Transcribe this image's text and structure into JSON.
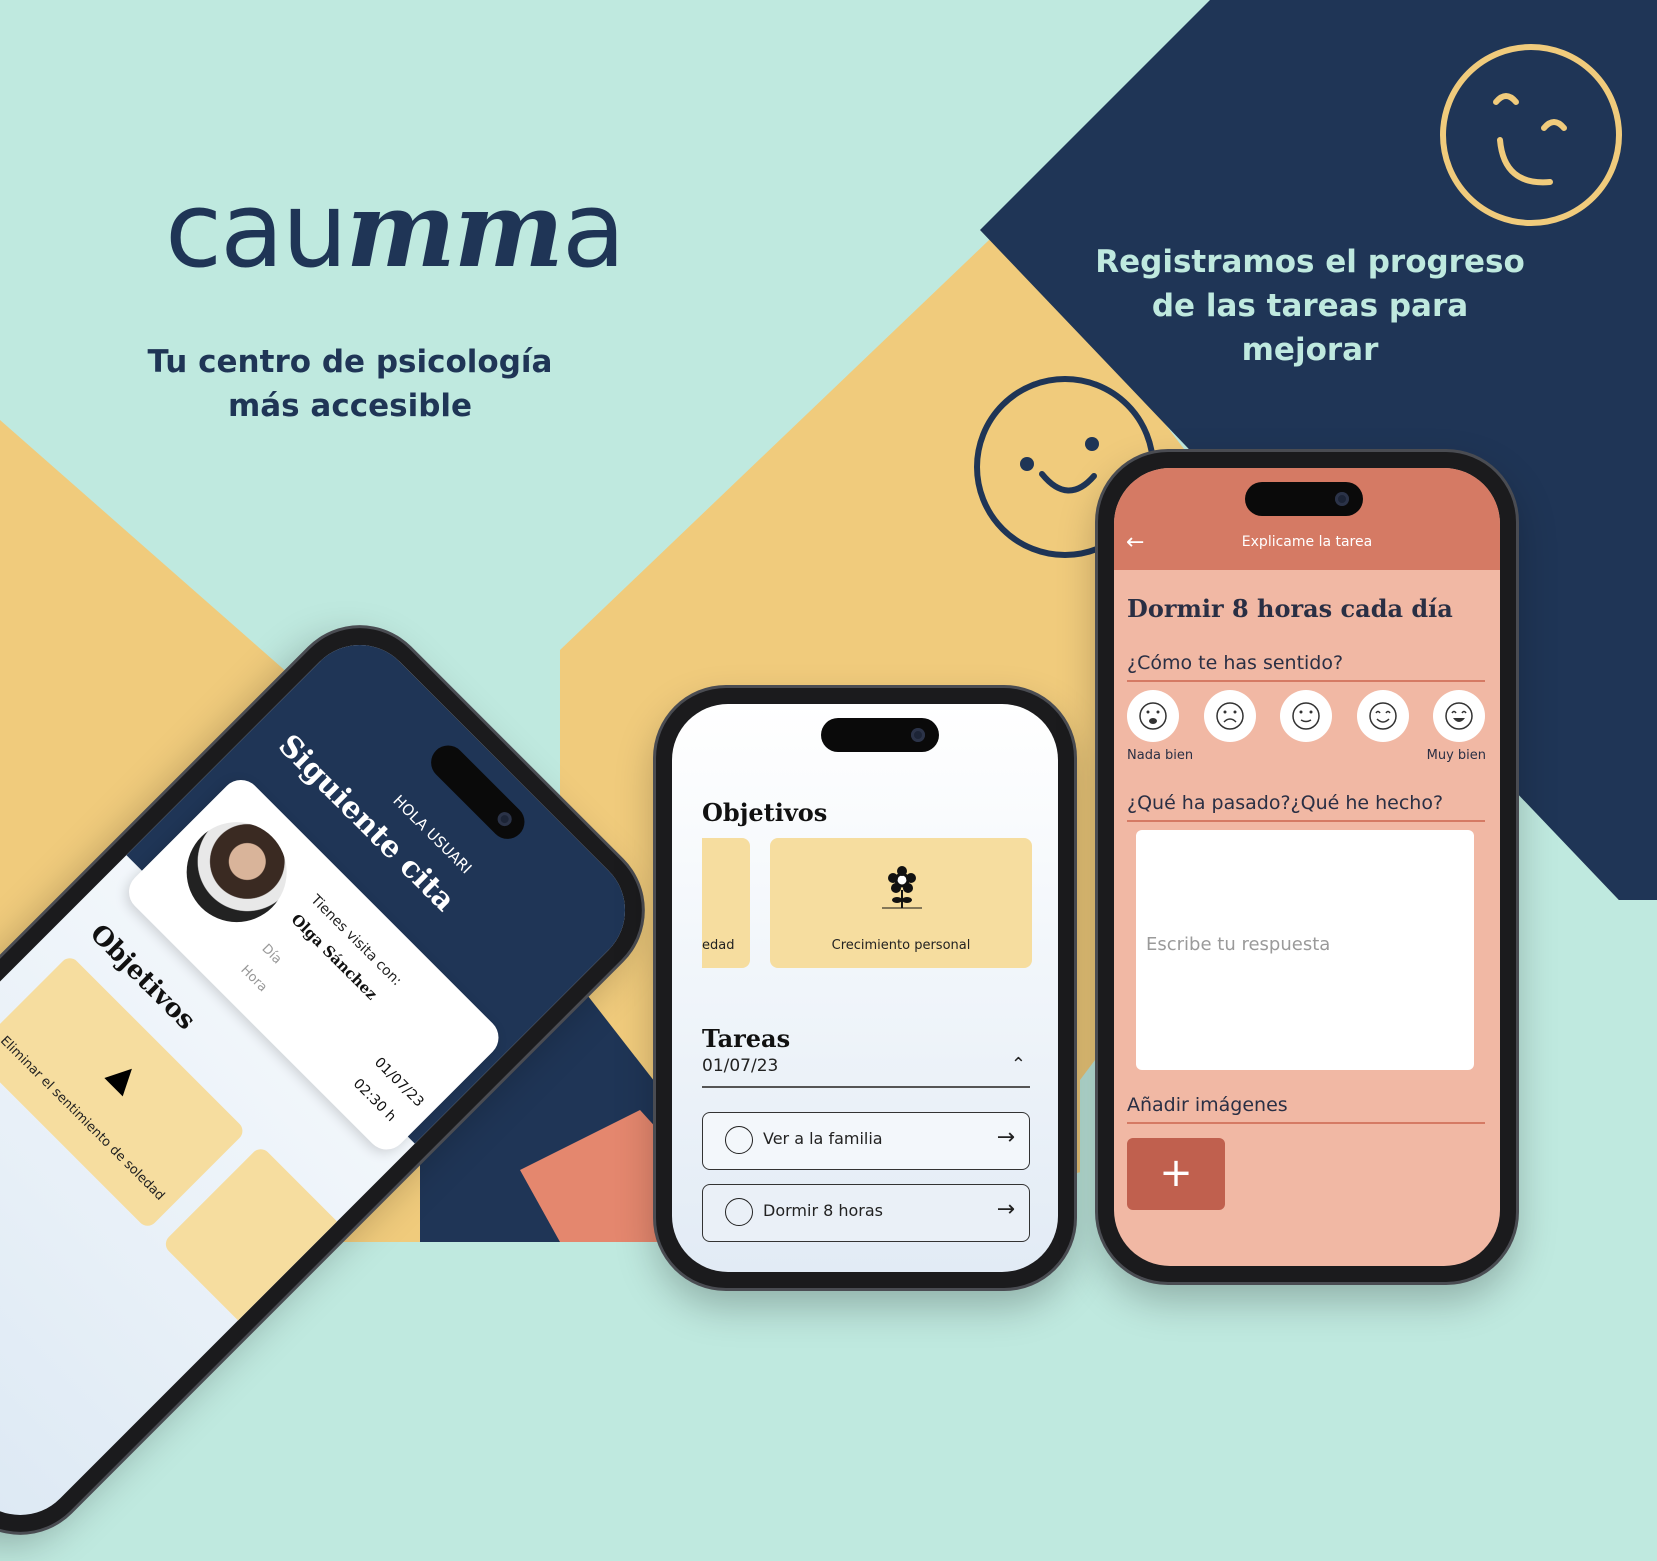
{
  "brand": {
    "logo_prefix": "cau",
    "logo_mid": "mm",
    "logo_suffix": "a",
    "tagline_line1": "Tu centro de psicología",
    "tagline_line2": "más accesible"
  },
  "promo": {
    "line1": "Registramos el progreso",
    "line2": "de las tareas para",
    "line3": "mejorar"
  },
  "colors": {
    "mint": "#bfe9df",
    "navy": "#1f3556",
    "yellow": "#f0cb7c",
    "coral": "#e4876e",
    "salmon_screen": "#f1b8a4",
    "header_coral": "#d57a64"
  },
  "phone_left": {
    "greeting": "HOLA USUARI",
    "section_title": "Siguiente cita",
    "visit_label": "Tienes visita con:",
    "therapist_name": "Olga Sánchez",
    "day_label": "Día",
    "day_value": "01/07/23",
    "hour_label": "Hora",
    "hour_value": "02:30 h",
    "objectives_title": "Objetivos",
    "objective_card": "Eliminar el sentimiento de soledad",
    "objective_icon": "lighthouse-icon"
  },
  "phone_mid": {
    "objectives_title": "Objetivos",
    "partial_card": "edad",
    "card_label": "Crecimiento personal",
    "card_icon": "flower-icon",
    "tasks_title": "Tareas",
    "date": "01/07/23",
    "tasks": [
      {
        "label": "Ver a la familia"
      },
      {
        "label": "Dormir 8 horas"
      }
    ]
  },
  "phone_right": {
    "header_title": "Explicame la tarea",
    "task_title": "Dormir 8 horas cada día",
    "q_feeling": "¿Cómo te has sentido?",
    "scale_low": "Nada bien",
    "scale_high": "Muy bien",
    "moods": [
      "very-sad-face-icon",
      "sad-face-icon",
      "neutral-face-icon",
      "happy-face-icon",
      "very-happy-face-icon"
    ],
    "q_happened": "¿Qué ha pasado?¿Qué he hecho?",
    "answer_placeholder": "Escribe tu respuesta",
    "add_images": "Añadir imágenes",
    "add_button": "+"
  }
}
